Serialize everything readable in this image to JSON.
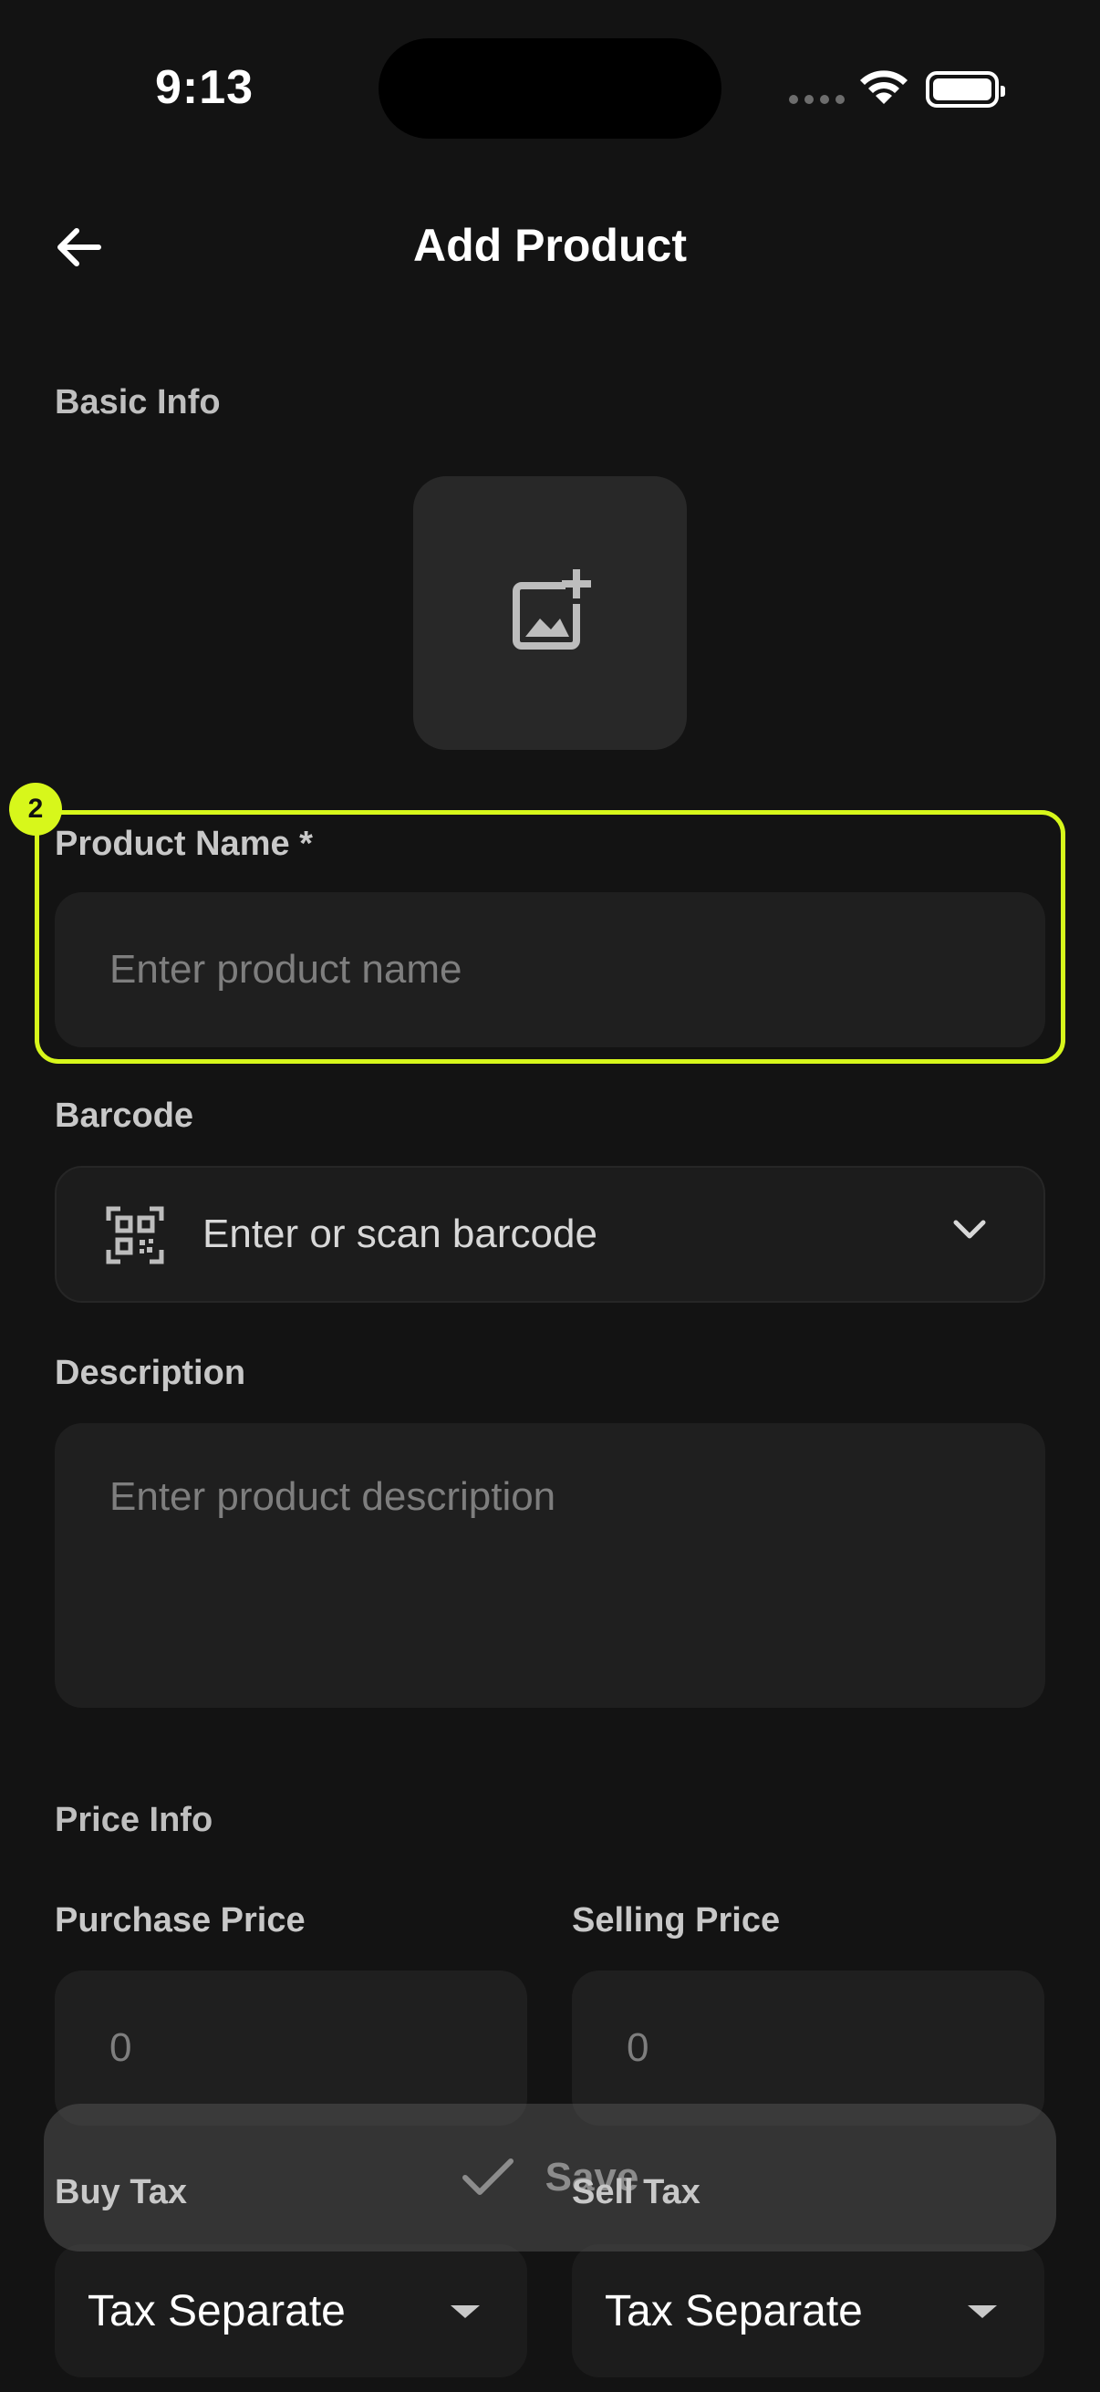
{
  "status_bar": {
    "time": "9:13"
  },
  "header": {
    "title": "Add Product"
  },
  "basic_info": {
    "section_label": "Basic Info",
    "product_name": {
      "label": "Product Name *",
      "placeholder": "Enter product name"
    },
    "barcode": {
      "label": "Barcode",
      "placeholder": "Enter or scan barcode"
    },
    "description": {
      "label": "Description",
      "placeholder": "Enter product description"
    }
  },
  "price_info": {
    "section_label": "Price Info",
    "purchase_price": {
      "label": "Purchase Price",
      "placeholder": "0"
    },
    "selling_price": {
      "label": "Selling Price",
      "placeholder": "0"
    },
    "buy_tax": {
      "label": "Buy Tax",
      "value": "Tax Separate"
    },
    "sell_tax": {
      "label": "Sell Tax",
      "value": "Tax Separate"
    }
  },
  "annotation": {
    "badge": "2"
  },
  "actions": {
    "save_label": "Save"
  },
  "colors": {
    "accent": "#d7f71b",
    "background": "#131313",
    "field": "#1f1f1f"
  }
}
